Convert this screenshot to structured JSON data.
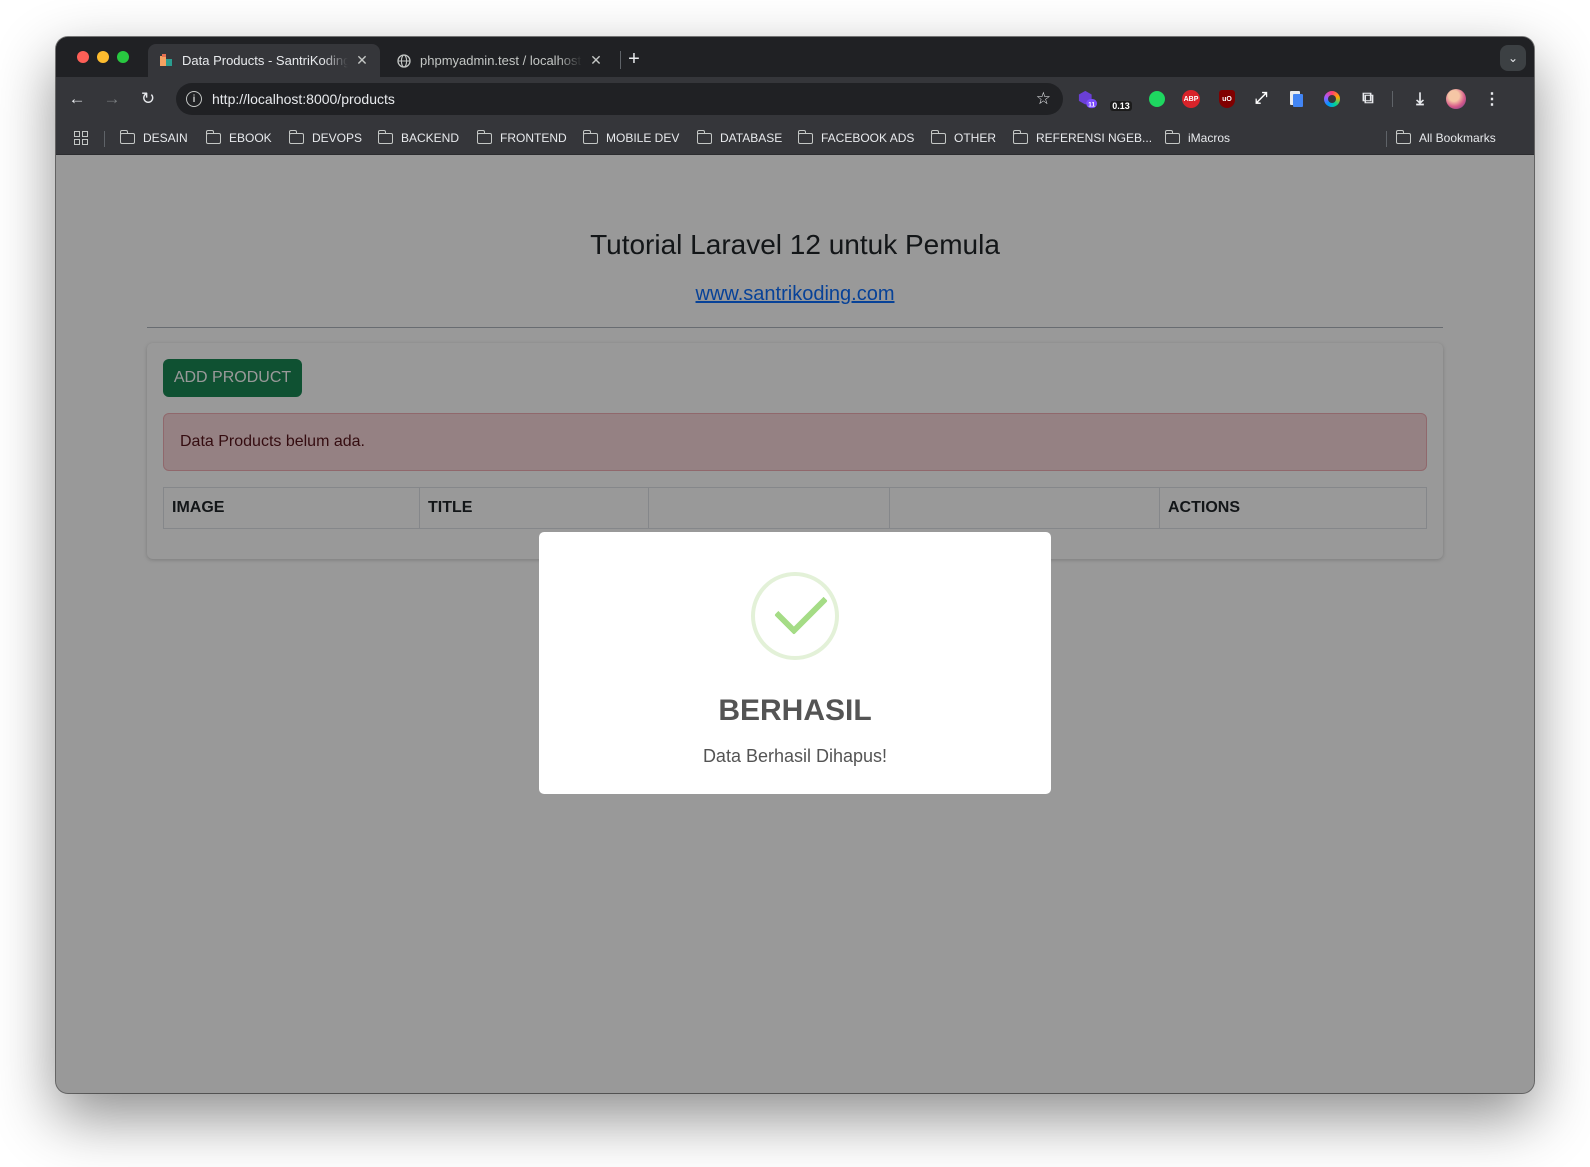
{
  "browser": {
    "tabs": [
      {
        "title": "Data Products - SantriKoding",
        "active": true
      },
      {
        "title": "phpmyadmin.test / localhost /",
        "active": false
      }
    ],
    "url": "http://localhost:8000/products",
    "extensions": {
      "badge_count": "11",
      "timer_value": "0.13",
      "abp_label": "ABP",
      "ublock_label": "uO"
    },
    "bookmarks": [
      "DESAIN",
      "EBOOK",
      "DEVOPS",
      "BACKEND",
      "FRONTEND",
      "MOBILE DEV",
      "DATABASE",
      "FACEBOOK ADS",
      "OTHER",
      "REFERENSI NGEB...",
      "iMacros"
    ],
    "all_bookmarks": "All Bookmarks"
  },
  "page": {
    "title": "Tutorial Laravel 12 untuk Pemula",
    "link": "www.santrikoding.com",
    "add_button": "ADD PRODUCT",
    "alert": "Data Products belum ada.",
    "table_headers": [
      "IMAGE",
      "TITLE",
      "",
      "",
      "ACTIONS"
    ]
  },
  "modal": {
    "title": "BERHASIL",
    "message": "Data Berhasil Dihapus!"
  },
  "colors": {
    "success_button": "#198754",
    "alert_bg": "#f8d7da",
    "link": "#0d6efd",
    "success_check": "#a5dc86"
  }
}
